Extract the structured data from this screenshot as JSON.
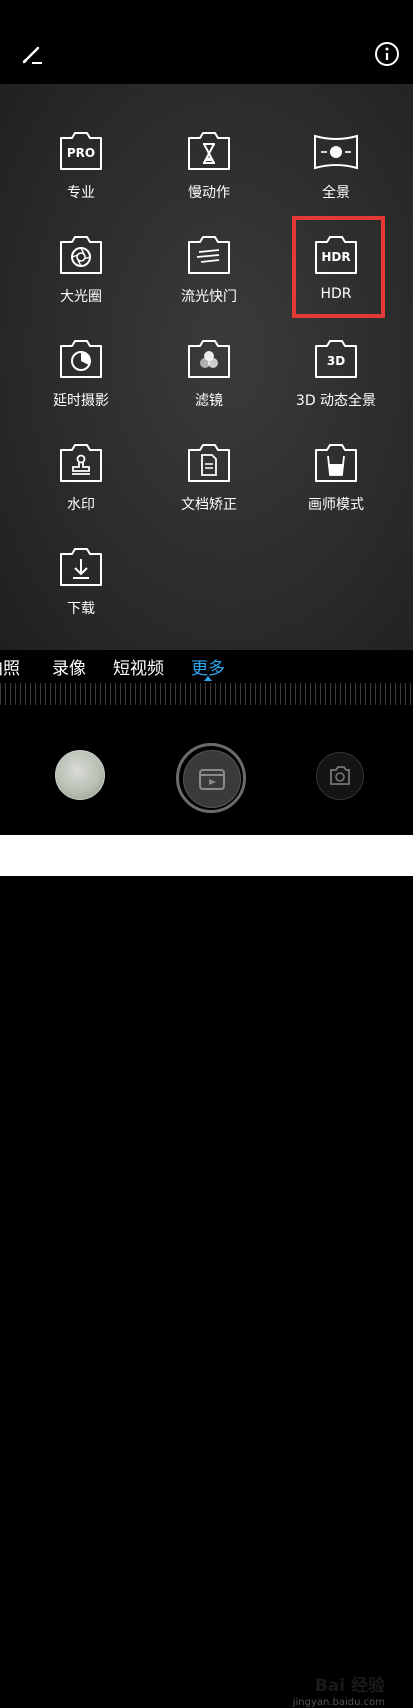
{
  "top": {
    "edit_icon": "pencil-edit-icon",
    "info_icon": "info-icon"
  },
  "modes": [
    {
      "id": "pro",
      "label": "专业",
      "icon": "pro-camera-icon"
    },
    {
      "id": "slowmo",
      "label": "慢动作",
      "icon": "hourglass-camera-icon"
    },
    {
      "id": "panorama",
      "label": "全景",
      "icon": "panorama-camera-icon"
    },
    {
      "id": "aperture",
      "label": "大光圈",
      "icon": "aperture-camera-icon"
    },
    {
      "id": "lightpainting",
      "label": "流光快门",
      "icon": "light-streak-camera-icon"
    },
    {
      "id": "hdr",
      "label": "HDR",
      "icon": "hdr-camera-icon"
    },
    {
      "id": "timelapse",
      "label": "延时摄影",
      "icon": "timelapse-camera-icon"
    },
    {
      "id": "filter",
      "label": "滤镜",
      "icon": "filter-camera-icon"
    },
    {
      "id": "pano3d",
      "label": "3D 动态全景",
      "icon": "3d-camera-icon"
    },
    {
      "id": "watermark",
      "label": "水印",
      "icon": "stamp-camera-icon"
    },
    {
      "id": "document",
      "label": "文档矫正",
      "icon": "document-camera-icon"
    },
    {
      "id": "artist",
      "label": "画师模式",
      "icon": "paint-cup-camera-icon"
    },
    {
      "id": "download",
      "label": "下载",
      "icon": "download-camera-icon"
    }
  ],
  "badges": {
    "pro": "PRO",
    "hdr": "HDR",
    "pano3d": "3D"
  },
  "tabs": [
    "拍照",
    "录像",
    "短视频",
    "更多"
  ],
  "active_tab": "更多",
  "colors": {
    "accent": "#2ea6f0",
    "highlight": "#e53935"
  },
  "watermark": {
    "main": "Bai 经验",
    "sub": "jingyan.baidu.com"
  }
}
